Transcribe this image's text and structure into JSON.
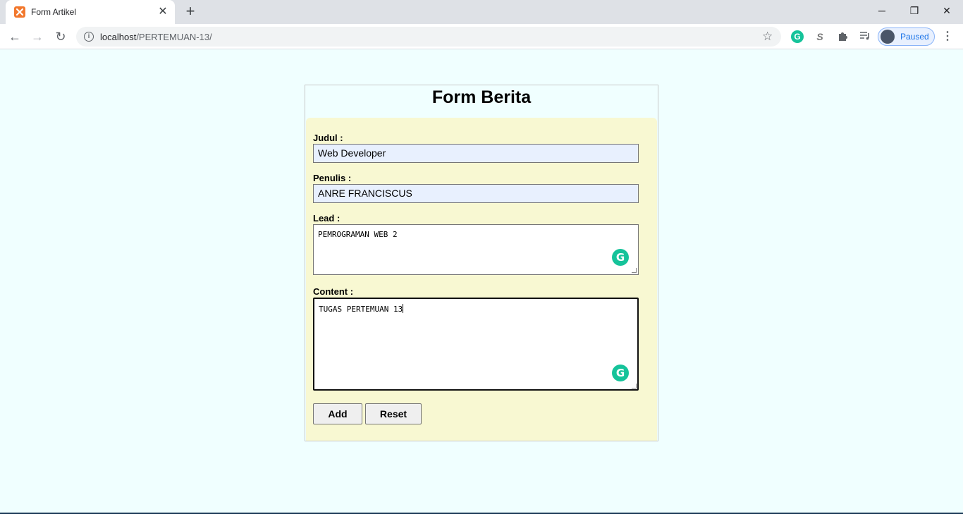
{
  "browser": {
    "tab_title": "Form Artikel",
    "tab_close": "✕",
    "new_tab": "+",
    "url_host": "localhost",
    "url_path": "/PERTEMUAN-13/",
    "profile_label": "Paused",
    "window_controls": {
      "minimize": "─",
      "maximize": "❐",
      "close": "✕"
    },
    "nav_icons": {
      "back": "←",
      "forward": "→",
      "reload": "↻",
      "star": "☆",
      "menu": "⋮"
    },
    "extensions": [
      "grammarly-icon",
      "s-extension-icon",
      "puzzle-icon",
      "media-control-icon"
    ],
    "accent": "#1a73e8"
  },
  "form": {
    "title": "Form Berita",
    "fields": {
      "judul": {
        "label": "Judul :",
        "value": "Web Developer"
      },
      "penulis": {
        "label": "Penulis :",
        "value": "ANRE FRANCISCUS"
      },
      "lead": {
        "label": "Lead :",
        "value": "PEMROGRAMAN WEB 2"
      },
      "content": {
        "label": "Content :",
        "value": "TUGAS PERTEMUAN 13"
      }
    },
    "buttons": {
      "add": "Add",
      "reset": "Reset"
    },
    "grammarly_glyph": "G",
    "colors": {
      "page_bg": "#f0ffff",
      "form_bg": "#f8f8d2",
      "autofill_bg": "#e8f0fe",
      "grammarly": "#15c39a"
    }
  }
}
